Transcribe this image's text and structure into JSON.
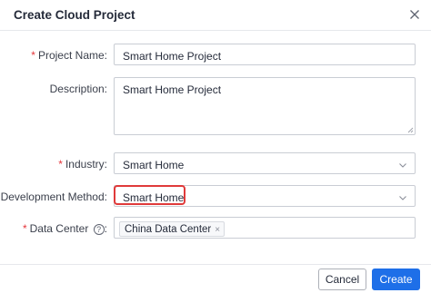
{
  "dialog": {
    "title": "Create Cloud Project",
    "close_icon": "close-icon"
  },
  "form": {
    "project_name": {
      "required_mark": "*",
      "label": "Project Name:",
      "value": "Smart Home Project"
    },
    "description": {
      "label": "Description:",
      "value": "Smart Home Project"
    },
    "industry": {
      "required_mark": "*",
      "label": "Industry:",
      "value": "Smart Home",
      "icon": "chevron-down-icon"
    },
    "development_method": {
      "required_mark": "*",
      "label": "Development Method:",
      "value": "Smart Home",
      "icon": "chevron-down-icon",
      "highlight_color": "#e03a3a"
    },
    "data_center": {
      "required_mark": "*",
      "label": "Data Center",
      "help_icon": "help-circle-icon",
      "help_glyph": "?",
      "colon": ":",
      "tags": [
        {
          "label": "China Data Center",
          "remove_glyph": "×"
        }
      ]
    }
  },
  "footer": {
    "cancel_label": "Cancel",
    "create_label": "Create"
  },
  "colors": {
    "primary": "#1e6fe8",
    "required": "#e5353a",
    "border": "#c9cdd4"
  }
}
